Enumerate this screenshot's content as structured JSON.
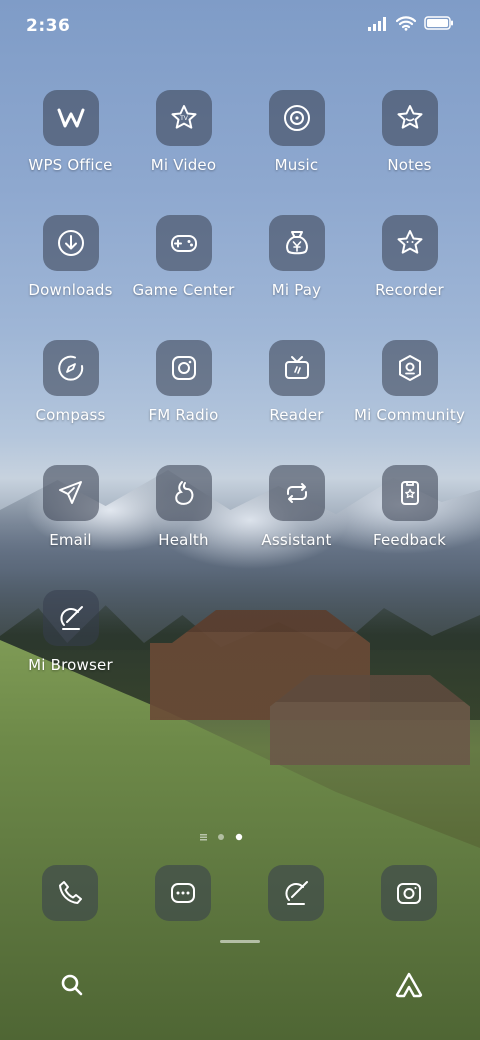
{
  "status": {
    "time": "2:36"
  },
  "apps": [
    {
      "label": "WPS Office",
      "icon": "wps-icon"
    },
    {
      "label": "Mi Video",
      "icon": "mi-video-icon"
    },
    {
      "label": "Music",
      "icon": "music-icon"
    },
    {
      "label": "Notes",
      "icon": "notes-icon"
    },
    {
      "label": "Downloads",
      "icon": "downloads-icon"
    },
    {
      "label": "Game Center",
      "icon": "game-center-icon"
    },
    {
      "label": "Mi Pay",
      "icon": "mi-pay-icon"
    },
    {
      "label": "Recorder",
      "icon": "recorder-icon"
    },
    {
      "label": "Compass",
      "icon": "compass-icon"
    },
    {
      "label": "FM Radio",
      "icon": "fm-radio-icon"
    },
    {
      "label": "Reader",
      "icon": "reader-icon"
    },
    {
      "label": "Mi Community",
      "icon": "mi-community-icon"
    },
    {
      "label": "Email",
      "icon": "email-icon"
    },
    {
      "label": "Health",
      "icon": "health-icon"
    },
    {
      "label": "Assistant",
      "icon": "assistant-icon"
    },
    {
      "label": "Feedback",
      "icon": "feedback-icon"
    },
    {
      "label": "Mi Browser",
      "icon": "mi-browser-icon"
    }
  ],
  "dock": [
    {
      "icon": "phone-icon"
    },
    {
      "icon": "messages-icon"
    },
    {
      "icon": "browser-icon"
    },
    {
      "icon": "camera-icon"
    }
  ],
  "bottom": [
    {
      "icon": "search-icon"
    },
    {
      "icon": "assistant-triangle-icon"
    }
  ]
}
